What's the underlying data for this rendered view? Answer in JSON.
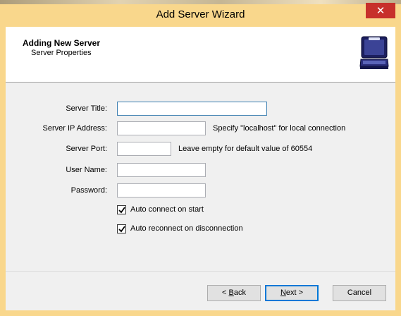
{
  "window": {
    "title": "Add Server Wizard",
    "close_glyph": "✕",
    "accent_color": "#f9d78c",
    "close_color": "#c7302b"
  },
  "header": {
    "title": "Adding New Server",
    "subtitle": "Server Properties",
    "icon": "laptop-icon"
  },
  "form": {
    "server_title": {
      "label": "Server Title:",
      "value": ""
    },
    "server_ip": {
      "label": "Server IP Address:",
      "value": "",
      "hint": "Specify \"localhost\" for local connection"
    },
    "server_port": {
      "label": "Server Port:",
      "value": "",
      "hint": "Leave empty for default value of 60554"
    },
    "user_name": {
      "label": "User Name:",
      "value": ""
    },
    "password": {
      "label": "Password:",
      "value": ""
    },
    "auto_connect": {
      "label": "Auto connect on start",
      "checked": true
    },
    "auto_reconnect": {
      "label": "Auto reconnect on disconnection",
      "checked": true
    }
  },
  "buttons": {
    "back_prefix": "< ",
    "back_mnemonic": "B",
    "back_rest": "ack",
    "next_mnemonic": "N",
    "next_rest": "ext >",
    "cancel": "Cancel"
  }
}
